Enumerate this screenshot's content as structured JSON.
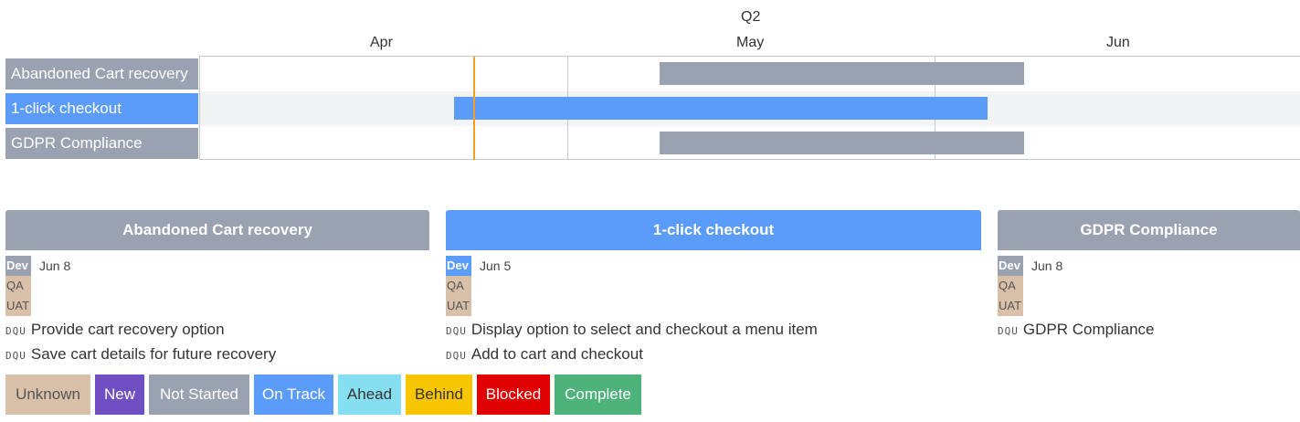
{
  "timeline": {
    "quarter": "Q2",
    "months": [
      "Apr",
      "May",
      "Jun"
    ]
  },
  "rows": [
    {
      "label": "Abandoned Cart recovery",
      "status": "Not Started",
      "color": "#9aa1b0",
      "start": "May 1",
      "end": "Jun 3"
    },
    {
      "label": "1-click checkout",
      "status": "On Track",
      "color": "#5b9cf8",
      "start": "Apr 20",
      "end": "Jun 1"
    },
    {
      "label": "GDPR Compliance",
      "status": "Not Started",
      "color": "#9aa1b0",
      "start": "May 1",
      "end": "Jun 3"
    }
  ],
  "cards": [
    {
      "title": "Abandoned Cart recovery",
      "color": "#9aa1b0",
      "tags": [
        "Dev",
        "QA",
        "UAT"
      ],
      "dev_date": "Jun 8",
      "items": [
        "Provide cart recovery option",
        "Save cart details for future recovery"
      ]
    },
    {
      "title": "1-click checkout",
      "color": "#5b9cf8",
      "tags": [
        "Dev",
        "QA",
        "UAT"
      ],
      "dev_date": "Jun 5",
      "items": [
        "Display option to select and checkout a menu item",
        "Add to cart and checkout"
      ]
    },
    {
      "title": "GDPR Compliance",
      "color": "#9aa1b0",
      "tags": [
        "Dev",
        "QA",
        "UAT"
      ],
      "dev_date": "Jun 8",
      "items": [
        "GDPR Compliance"
      ]
    }
  ],
  "item_prefix": "DQU",
  "legend": [
    {
      "label": "Unknown",
      "bg": "#d9c0a8",
      "fg": "#555555"
    },
    {
      "label": "New",
      "bg": "#6f4fc1",
      "fg": "#ffffff"
    },
    {
      "label": "Not Started",
      "bg": "#9aa1b0",
      "fg": "#ffffff"
    },
    {
      "label": "On Track",
      "bg": "#5b9cf8",
      "fg": "#ffffff"
    },
    {
      "label": "Ahead",
      "bg": "#86dff0",
      "fg": "#333333"
    },
    {
      "label": "Behind",
      "bg": "#f7c600",
      "fg": "#333333"
    },
    {
      "label": "Blocked",
      "bg": "#e00000",
      "fg": "#ffffff"
    },
    {
      "label": "Complete",
      "bg": "#4db37a",
      "fg": "#ffffff"
    }
  ]
}
